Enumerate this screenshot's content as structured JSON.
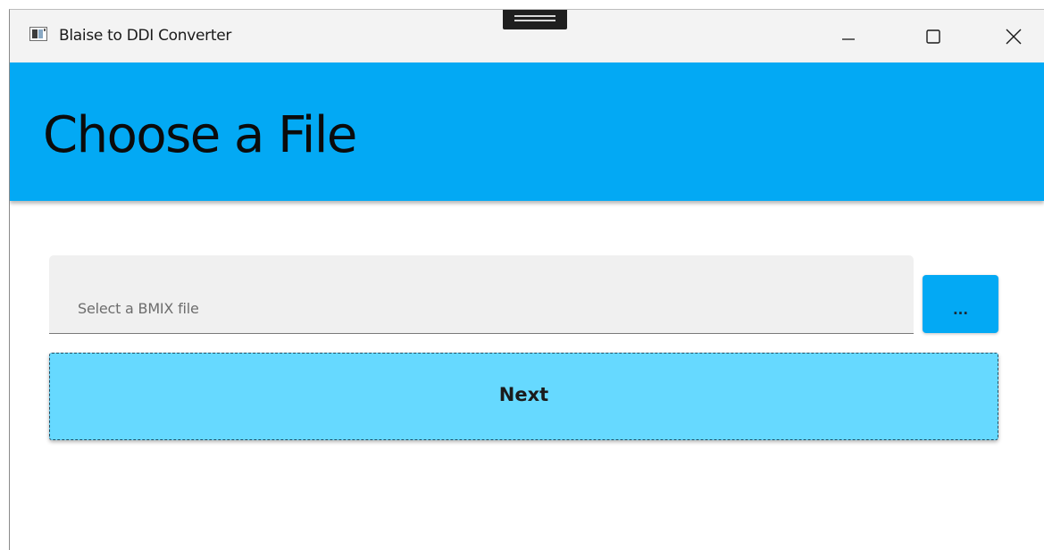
{
  "window": {
    "title": "Blaise to DDI Converter",
    "controls": {
      "minimize_icon": "minimize-icon",
      "maximize_icon": "maximize-icon",
      "close_icon": "close-icon"
    }
  },
  "header": {
    "title": "Choose a File",
    "background_color": "#03a9f4"
  },
  "file_picker": {
    "placeholder": "Select a BMIX file",
    "value": "",
    "browse_label": "..."
  },
  "actions": {
    "next_label": "Next",
    "next_color": "#66d9ff"
  }
}
